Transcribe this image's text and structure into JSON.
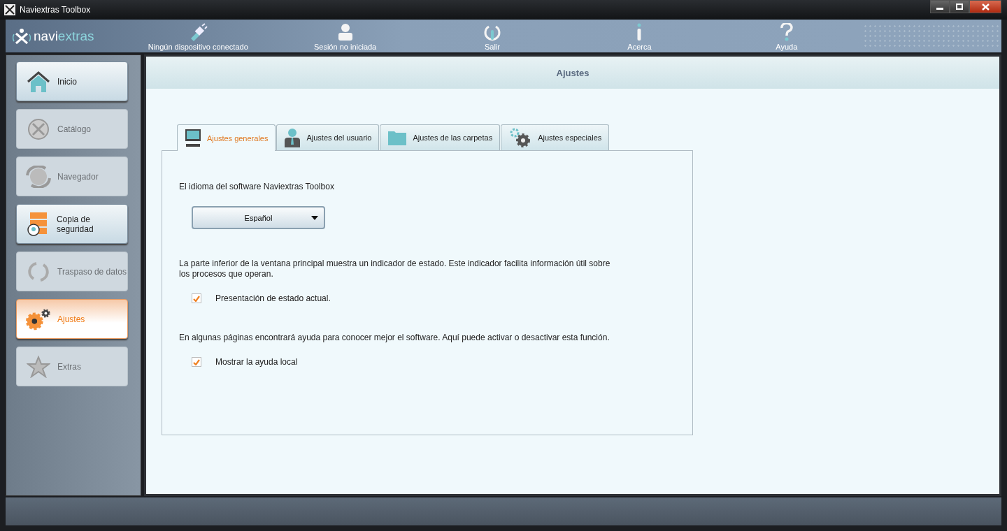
{
  "window": {
    "title": "Naviextras Toolbox"
  },
  "logo": {
    "text_part1": "navi",
    "text_part2": "extras"
  },
  "toolbar": [
    {
      "label": "Ningún dispositivo conectado"
    },
    {
      "label": "Sesión no iniciada"
    },
    {
      "label": "Salir"
    },
    {
      "label": "Acerca"
    },
    {
      "label": "Ayuda"
    }
  ],
  "sidebar": {
    "items": [
      {
        "label": "Inicio",
        "selected": false,
        "disabled": false
      },
      {
        "label": "Catálogo",
        "selected": false,
        "disabled": true
      },
      {
        "label": "Navegador",
        "selected": false,
        "disabled": true
      },
      {
        "label": "Copia de seguridad",
        "selected": false,
        "disabled": false
      },
      {
        "label": "Traspaso de datos",
        "selected": false,
        "disabled": true
      },
      {
        "label": "Ajustes",
        "selected": true,
        "disabled": false
      },
      {
        "label": "Extras",
        "selected": false,
        "disabled": true
      }
    ]
  },
  "page": {
    "title": "Ajustes"
  },
  "tabs": [
    {
      "label": "Ajustes generales",
      "selected": true
    },
    {
      "label": "Ajustes del usuario",
      "selected": false
    },
    {
      "label": "Ajustes de las carpetas",
      "selected": false
    },
    {
      "label": "Ajustes especiales",
      "selected": false
    }
  ],
  "language": {
    "label": "El idioma del software Naviextras Toolbox",
    "value": "Español"
  },
  "options": [
    {
      "description": "La parte inferior de la ventana principal muestra un indicador de estado. Este indicador facilita información útil sobre los procesos que operan.",
      "label": "Presentación de estado actual.",
      "checked": true
    },
    {
      "description": "En algunas páginas encontrará ayuda para conocer mejor el software. Aquí puede activar o desactivar esta función.",
      "label": "Mostrar la ayuda local",
      "checked": true
    }
  ]
}
